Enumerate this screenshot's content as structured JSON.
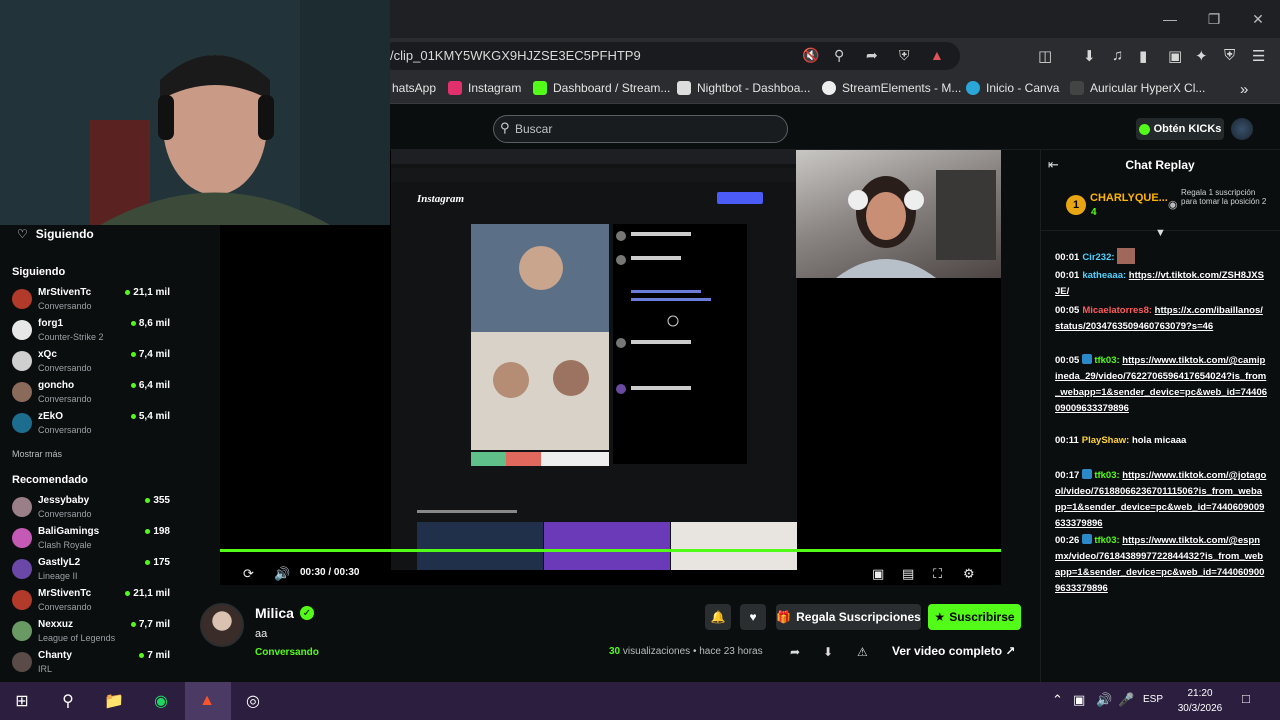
{
  "browser": {
    "url": "/clip_01KMY5WKGX9HJZSE3EC5PFHTP9",
    "bookmarks": [
      "hatsApp",
      "Instagram",
      "Dashboard / Stream...",
      "Nightbot - Dashboa...",
      "StreamElements - M...",
      "Inicio - Canva",
      "Auricular HyperX Cl..."
    ],
    "overflow": "»"
  },
  "header": {
    "search_placeholder": "Buscar",
    "kicks_label": "Obtén KICKs"
  },
  "sidebar": {
    "following_title": "Siguiendo",
    "following_section": "Siguiendo",
    "following": [
      {
        "name": "MrStivenTc",
        "sub": "Conversando",
        "count": "21,1 mil",
        "color": "#b23a2a"
      },
      {
        "name": "forg1",
        "sub": "Counter-Strike 2",
        "count": "8,6 mil",
        "color": "#e7e7e7"
      },
      {
        "name": "xQc",
        "sub": "Conversando",
        "count": "7,4 mil",
        "color": "#cfcfcf"
      },
      {
        "name": "goncho",
        "sub": "Conversando",
        "count": "6,4 mil",
        "color": "#8a6a5a"
      },
      {
        "name": "zEkO",
        "sub": "Conversando",
        "count": "5,4 mil",
        "color": "#1d6e8e"
      }
    ],
    "show_more": "Mostrar más",
    "recommended_section": "Recomendado",
    "recommended": [
      {
        "name": "Jessybaby",
        "sub": "Conversando",
        "count": "355",
        "color": "#9a7f88"
      },
      {
        "name": "BaliGamings",
        "sub": "Clash Royale",
        "count": "198",
        "color": "#c45ab5"
      },
      {
        "name": "GastlyL2",
        "sub": "Lineage II",
        "count": "175",
        "color": "#6b47a8"
      },
      {
        "name": "MrStivenTc",
        "sub": "Conversando",
        "count": "21,1 mil",
        "color": "#b23a2a"
      },
      {
        "name": "Nexxuz",
        "sub": "League of Legends",
        "count": "7,7 mil",
        "color": "#6a9a64"
      },
      {
        "name": "Chanty",
        "sub": "IRL",
        "count": "7 mil",
        "color": "#5a4a48"
      }
    ]
  },
  "player": {
    "time": "00:30 / 00:30",
    "progress_fraction": 1.0
  },
  "clip": {
    "streamer": "Milica",
    "title": "aa",
    "category": "Conversando",
    "views_count": "30",
    "views_label": "visualizaciones",
    "ago": "• hace 23 horas",
    "gift_label": "Regala Suscripciones",
    "subscribe_label": "Suscribirse",
    "full_video_label": "Ver video completo"
  },
  "chat": {
    "title": "Chat Replay",
    "pinned_rank": "1",
    "pinned_name": "CHARLYQUE...",
    "pinned_count": "4",
    "pinned_note": "Regala 1 suscripción para tomar la posición 2",
    "messages": [
      {
        "ts": "00:01",
        "user": "Cir232:",
        "color": "#4fd1ff",
        "text": ""
      },
      {
        "ts": "00:01",
        "user": "katheaaa:",
        "color": "#4fd1ff",
        "text": "https://vt.tiktok.com/ZSH8JXSJE/"
      },
      {
        "ts": "00:05",
        "user": "Micaelatorres8:",
        "color": "#ff5a5a",
        "text": "https://x.com/ibaillanos/status/2034763509460763079?s=46"
      },
      {
        "ts": "00:05",
        "user": "tfk03:",
        "color": "#53fc18",
        "text": "https://www.tiktok.com/@camipineda_29/video/7622706596417654024?is_from_webapp=1&sender_device=pc&web_id=7440609009633379896"
      },
      {
        "ts": "00:11",
        "user": "PlayShaw:",
        "color": "#ffd43b",
        "text": "hola micaaa"
      },
      {
        "ts": "00:17",
        "user": "tfk03:",
        "color": "#53fc18",
        "text": "https://www.tiktok.com/@jotagool/video/7618806623670111506?is_from_webapp=1&sender_device=pc&web_id=7440609009633379896"
      },
      {
        "ts": "00:26",
        "user": "tfk03:",
        "color": "#53fc18",
        "text": "https://www.tiktok.com/@espnmx/video/7618438997722844432?is_from_webapp=1&sender_device=pc&web_id=7440609009633379896"
      }
    ]
  },
  "taskbar": {
    "lang": "ESP",
    "time": "21:20",
    "date": "30/3/2026"
  },
  "colors": {
    "accent": "#53fc18",
    "bg": "#0b0e0f",
    "taskbar": "#2b1e3e"
  }
}
